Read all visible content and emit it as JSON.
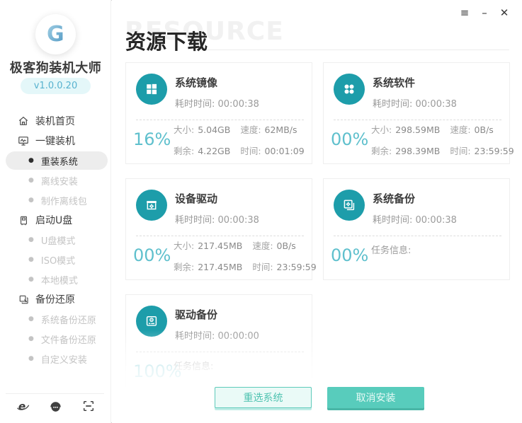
{
  "window": {
    "controls": [
      {
        "name": "menu",
        "glyph": "≡"
      },
      {
        "name": "minimize",
        "glyph": "–"
      },
      {
        "name": "close",
        "glyph": "✕"
      }
    ]
  },
  "sidebar": {
    "logo_letter": "G",
    "app_name": "极客狗装机大师",
    "version": "v1.0.0.20",
    "nav": [
      {
        "label": "装机首页",
        "level": "top",
        "icon": "home-icon"
      },
      {
        "label": "一键装机",
        "level": "top",
        "icon": "monitor-icon"
      },
      {
        "label": "重装系统",
        "level": "sub",
        "selected": true
      },
      {
        "label": "离线安装",
        "level": "sub"
      },
      {
        "label": "制作离线包",
        "level": "sub"
      },
      {
        "label": "启动U盘",
        "level": "top",
        "icon": "usb-icon"
      },
      {
        "label": "U盘模式",
        "level": "sub"
      },
      {
        "label": "ISO模式",
        "level": "sub"
      },
      {
        "label": "本地模式",
        "level": "sub"
      },
      {
        "label": "备份还原",
        "level": "top",
        "icon": "restore-icon"
      },
      {
        "label": "系统备份还原",
        "level": "sub"
      },
      {
        "label": "文件备份还原",
        "level": "sub"
      },
      {
        "label": "自定义安装",
        "level": "sub"
      }
    ],
    "footer_icons": [
      "ie-browser-icon",
      "support-headset-icon",
      "scan-icon"
    ]
  },
  "main": {
    "watermark": "RESOURCE",
    "title": "资源下载",
    "cards": [
      {
        "name": "system-image",
        "icon": "windows-icon",
        "title": "系统镜像",
        "elapsed_label": "耗时时间:",
        "elapsed": "00:00:38",
        "percent": "16%",
        "stats": [
          [
            "大小:",
            "5.04GB"
          ],
          [
            "速度:",
            "62MB/s"
          ],
          [
            "剩余:",
            "4.22GB"
          ],
          [
            "时间:",
            "00:01:09"
          ]
        ]
      },
      {
        "name": "system-software",
        "icon": "apps-icon",
        "title": "系统软件",
        "elapsed_label": "耗时时间:",
        "elapsed": "00:00:38",
        "percent": "00%",
        "stats": [
          [
            "大小:",
            "298.59MB"
          ],
          [
            "速度:",
            "0B/s"
          ],
          [
            "剩余:",
            "298.39MB"
          ],
          [
            "时间:",
            "23:59:59"
          ]
        ]
      },
      {
        "name": "device-driver",
        "icon": "driver-icon",
        "title": "设备驱动",
        "elapsed_label": "耗时时间:",
        "elapsed": "00:00:38",
        "percent": "00%",
        "stats": [
          [
            "大小:",
            "217.45MB"
          ],
          [
            "速度:",
            "0B/s"
          ],
          [
            "剩余:",
            "217.45MB"
          ],
          [
            "时间:",
            "23:59:59"
          ]
        ]
      },
      {
        "name": "system-backup",
        "icon": "backup-icon",
        "title": "系统备份",
        "elapsed_label": "耗时时间:",
        "elapsed": "00:00:38",
        "percent": "00%",
        "task_label": "任务信息:"
      },
      {
        "name": "driver-backup",
        "icon": "drive-icon",
        "title": "驱动备份",
        "elapsed_label": "耗时时间:",
        "elapsed": "00:00:00",
        "percent": "100%",
        "task_label": "任务信息:",
        "faded": true
      }
    ],
    "buttons": {
      "reselect": "重选系统",
      "cancel": "取消安装"
    }
  },
  "colors": {
    "accent_icon": "#1d9daa",
    "percent_text": "#5fc0cd",
    "button_teal": "#58ccbc",
    "button_light_bg": "#eafaf7",
    "version_bg": "#e4f7f9",
    "version_text": "#57b2cf",
    "selected_nav_bg": "#ededed",
    "muted_text": "#9b9b9b",
    "disabled_nav_text": "#c4c4c4"
  }
}
